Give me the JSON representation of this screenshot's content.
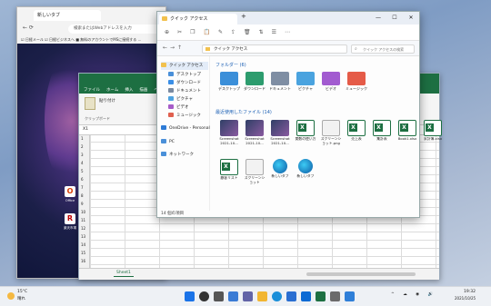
{
  "edge": {
    "tab_title": "新しいタブ",
    "address": "検索またはWebアドレスを入力",
    "bookmarks": "☑ 日経メール  ☑ 日経ビジネスへ  ■ 無料のアカウントでMSに接続する ...",
    "desktop_icons": [
      {
        "label": "Office",
        "glyph": "O",
        "color": "#d83b01"
      },
      {
        "label": "楽天市場",
        "glyph": "R",
        "color": "#bf0000"
      }
    ]
  },
  "excel": {
    "ribbon_tabs": [
      "ファイル",
      "ホーム",
      "挿入",
      "描画",
      "ページレイアウト",
      "数式",
      "データ"
    ],
    "ribbon_labels": [
      "貼り付け",
      "クリップボード"
    ],
    "name_box": "X1",
    "sheet_tab": "Sheet1",
    "row_numbers": [
      "1",
      "2",
      "3",
      "4",
      "5",
      "6",
      "7",
      "8",
      "9",
      "10",
      "11",
      "12",
      "13",
      "14",
      "15",
      "16"
    ]
  },
  "explorer": {
    "tab_title": "クイック アクセス",
    "path": "クイック アクセス",
    "search_placeholder": "クイック アクセスの検索",
    "sidebar": [
      {
        "label": "クイック アクセス",
        "color": "#f2c14e",
        "selected": true
      },
      {
        "label": "デスクトップ",
        "color": "#4a90d9"
      },
      {
        "label": "ダウンロード",
        "color": "#3a8ee6"
      },
      {
        "label": "ドキュメント",
        "color": "#7a8aa0"
      },
      {
        "label": "ピクチャ",
        "color": "#4fa3e0"
      },
      {
        "label": "ビデオ",
        "color": "#a65cc8"
      },
      {
        "label": "ミュージック",
        "color": "#e0604f"
      },
      {
        "label": "OneDrive - Personal",
        "color": "#2e7bd6"
      },
      {
        "label": "PC",
        "color": "#4a90d9"
      },
      {
        "label": "ネットワーク",
        "color": "#4a90d9"
      }
    ],
    "folders_header": "フォルダー (6)",
    "folders": [
      {
        "label": "デスクトップ",
        "color": "#3b8fd9"
      },
      {
        "label": "ダウンロード",
        "color": "#2d9c6e"
      },
      {
        "label": "ドキュメント",
        "color": "#7f8ea3"
      },
      {
        "label": "ピクチャ",
        "color": "#4aa3df"
      },
      {
        "label": "ビデオ",
        "color": "#a25bd0"
      },
      {
        "label": "ミュージック",
        "color": "#e55b48"
      }
    ],
    "recent_header": "最近使用したファイル (14)",
    "recent_files": [
      {
        "label": "Screenshot 2021-10...",
        "kind": "img"
      },
      {
        "label": "Screenshot 2021-10...",
        "kind": "img"
      },
      {
        "label": "Screenshot 2021-10...",
        "kind": "img"
      },
      {
        "label": "関数の使い方",
        "kind": "xl"
      },
      {
        "label": "スクリーンショット.png",
        "kind": "png"
      },
      {
        "label": "売上表",
        "kind": "xl"
      },
      {
        "label": "集計表",
        "kind": "xl"
      },
      {
        "label": "Book1.xlsx",
        "kind": "xl"
      },
      {
        "label": "家計簿.xlsx",
        "kind": "xl"
      },
      {
        "label": "顧客リスト",
        "kind": "xl"
      },
      {
        "label": "スクリーンショット",
        "kind": "png"
      },
      {
        "label": "新しいタブ",
        "kind": "edge"
      },
      {
        "label": "新しいタブ",
        "kind": "edge"
      }
    ],
    "status": "14 個の項目"
  },
  "taskbar": {
    "weather_temp": "15°C",
    "weather_desc": "晴れ",
    "icons": [
      {
        "name": "start",
        "color": "#1a73e8"
      },
      {
        "name": "search",
        "color": "#333333"
      },
      {
        "name": "task-view",
        "color": "#555555"
      },
      {
        "name": "widgets",
        "color": "#3a7bd5"
      },
      {
        "name": "teams-chat",
        "color": "#6264a7"
      },
      {
        "name": "file-explorer",
        "color": "#f2b632"
      },
      {
        "name": "edge",
        "color": "#1b8fd9"
      },
      {
        "name": "store",
        "color": "#2a6ed1"
      },
      {
        "name": "mail",
        "color": "#0b6ad4"
      },
      {
        "name": "excel",
        "color": "#1d6f42"
      },
      {
        "name": "settings",
        "color": "#6b6b6b"
      },
      {
        "name": "photos",
        "color": "#2f7fd8"
      }
    ],
    "time": "19:32",
    "date": "2021/10/25"
  }
}
